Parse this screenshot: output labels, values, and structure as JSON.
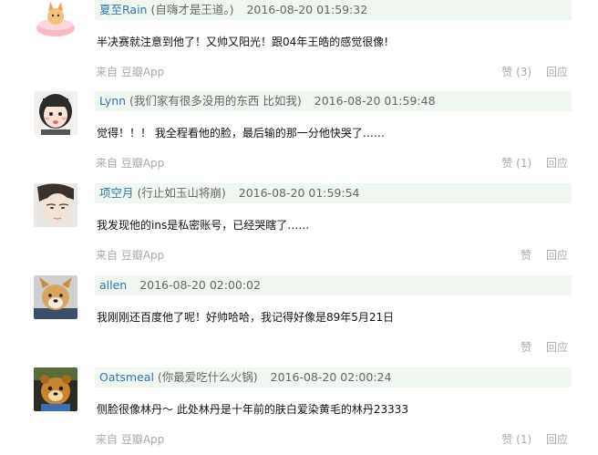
{
  "comments": [
    {
      "author": "夏至Rain",
      "signature": "(自嗨才是王道。)",
      "timestamp": "2016-08-20 01:59:32",
      "text": "半决赛就注意到他了！又帅又阳光！跟04年王皓的感觉很像!",
      "source_prefix": "来自",
      "source_app": "豆瓣App",
      "like_label": "赞",
      "like_count": "(3)",
      "reply_label": "回应",
      "avatar_icon": "pink-cat-bowl-avatar-icon"
    },
    {
      "author": "Lynn",
      "signature": "(我们家有很多没用的东西 比如我)",
      "timestamp": "2016-08-20 01:59:48",
      "text": "觉得！！！ 我全程看他的脸，最后输的那一分他快哭了……",
      "source_prefix": "来自",
      "source_app": "豆瓣App",
      "like_label": "赞",
      "like_count": "(1)",
      "reply_label": "回应",
      "avatar_icon": "cartoon-girl-avatar-icon"
    },
    {
      "author": "项空月",
      "signature": "(行止如玉山将崩)",
      "timestamp": "2016-08-20 01:59:54",
      "text": "我发现他的ins是私密账号，已经哭瞎了……",
      "source_prefix": "来自",
      "source_app": "豆瓣App",
      "like_label": "赞",
      "like_count": "",
      "reply_label": "回应",
      "avatar_icon": "man-portrait-avatar-icon"
    },
    {
      "author": "allen",
      "signature": "",
      "timestamp": "2016-08-20 02:00:02",
      "text": "我刚刚还百度他了呢！好帅哈哈，我记得好像是89年5月21日",
      "source_prefix": "",
      "source_app": "",
      "like_label": "赞",
      "like_count": "",
      "reply_label": "回应",
      "avatar_icon": "dog-avatar-icon"
    },
    {
      "author": "Oatsmeal",
      "signature": "(你最爱吃什么火锅)",
      "timestamp": "2016-08-20 02:00:24",
      "text": "侧脸很像林丹～ 此处林丹是十年前的肤白爱染黄毛的林丹23333",
      "source_prefix": "来自",
      "source_app": "豆瓣App",
      "like_label": "赞",
      "like_count": "(1)",
      "reply_label": "回应",
      "avatar_icon": "cartoon-bear-avatar-icon"
    }
  ],
  "colors": {
    "author_link": "#3377aa",
    "meta_bar_bg": "#f0f6f0",
    "muted": "#aaaaaa"
  }
}
